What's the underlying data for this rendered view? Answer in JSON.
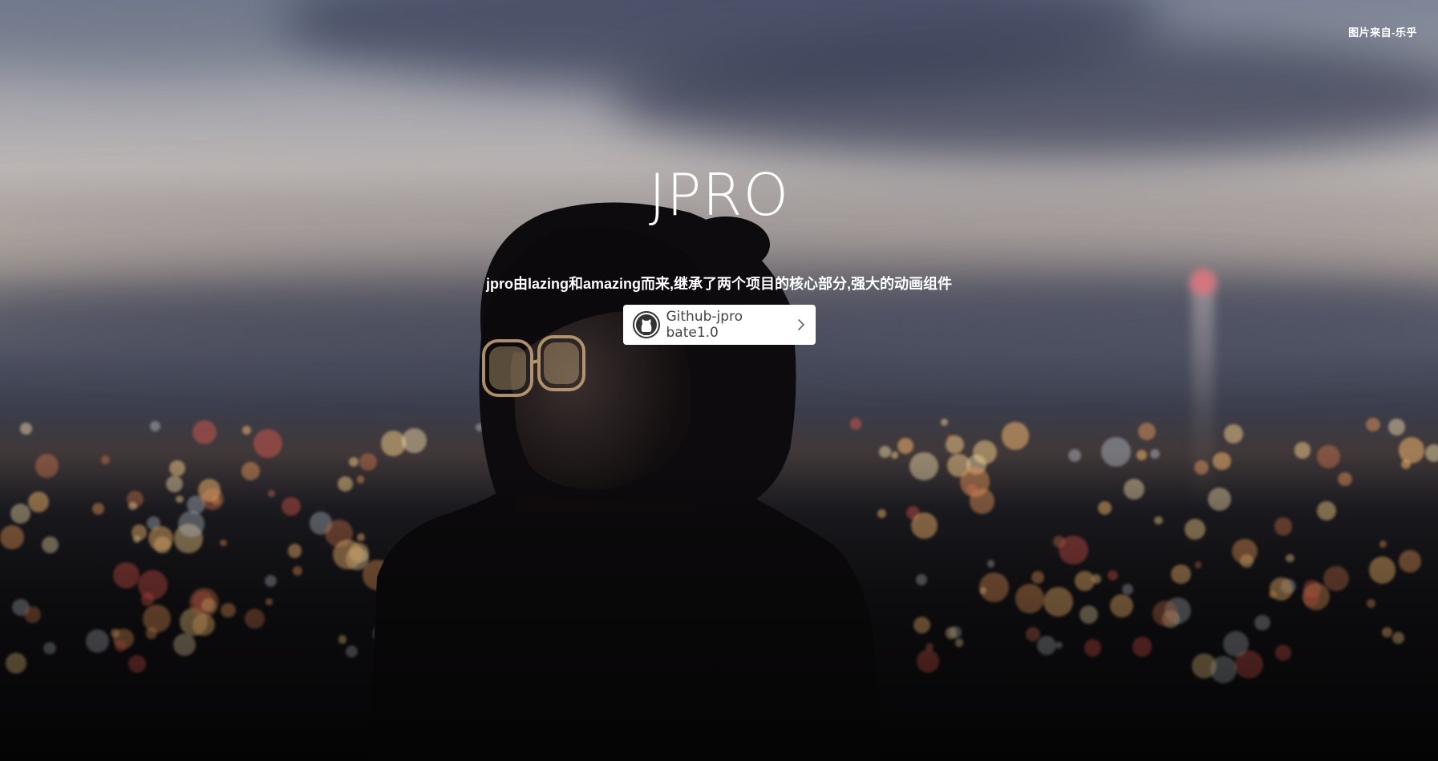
{
  "credit": "图片来自-乐乎",
  "title": "JPRO",
  "subtitle": "jpro由lazing和amazing而来,继承了两个项目的核心部分,强大的动画组件",
  "button": {
    "label": "Github-jpro bate1.0",
    "icon": "github-octocat-icon",
    "trailing_icon": "chevron-right-icon"
  },
  "colors": {
    "text": "#ffffff",
    "button_bg": "#ffffff",
    "button_text": "#444444"
  }
}
